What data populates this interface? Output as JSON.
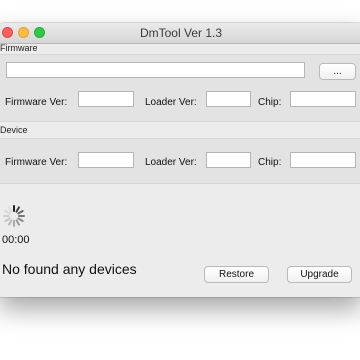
{
  "window": {
    "title": "DmTool Ver 1.3"
  },
  "firmware_section": {
    "label": "Firmware",
    "path_value": "",
    "browse_label": "...",
    "firmware_ver_label": "Firmware Ver:",
    "firmware_ver_value": "",
    "loader_ver_label": "Loader Ver:",
    "loader_ver_value": "",
    "chip_label": "Chip:",
    "chip_value": ""
  },
  "device_section": {
    "label": "Device",
    "firmware_ver_label": "Firmware Ver:",
    "firmware_ver_value": "",
    "loader_ver_label": "Loader Ver:",
    "loader_ver_value": "",
    "chip_label": "Chip:",
    "chip_value": ""
  },
  "progress": {
    "timer": "00:00",
    "spinner_icon": "spinner-icon"
  },
  "status_text": "No found any devices",
  "buttons": {
    "restore": "Restore",
    "upgrade": "Upgrade"
  },
  "colors": {
    "close": "#fc605c",
    "minimize": "#fdbc40",
    "maximize": "#34c84a"
  }
}
